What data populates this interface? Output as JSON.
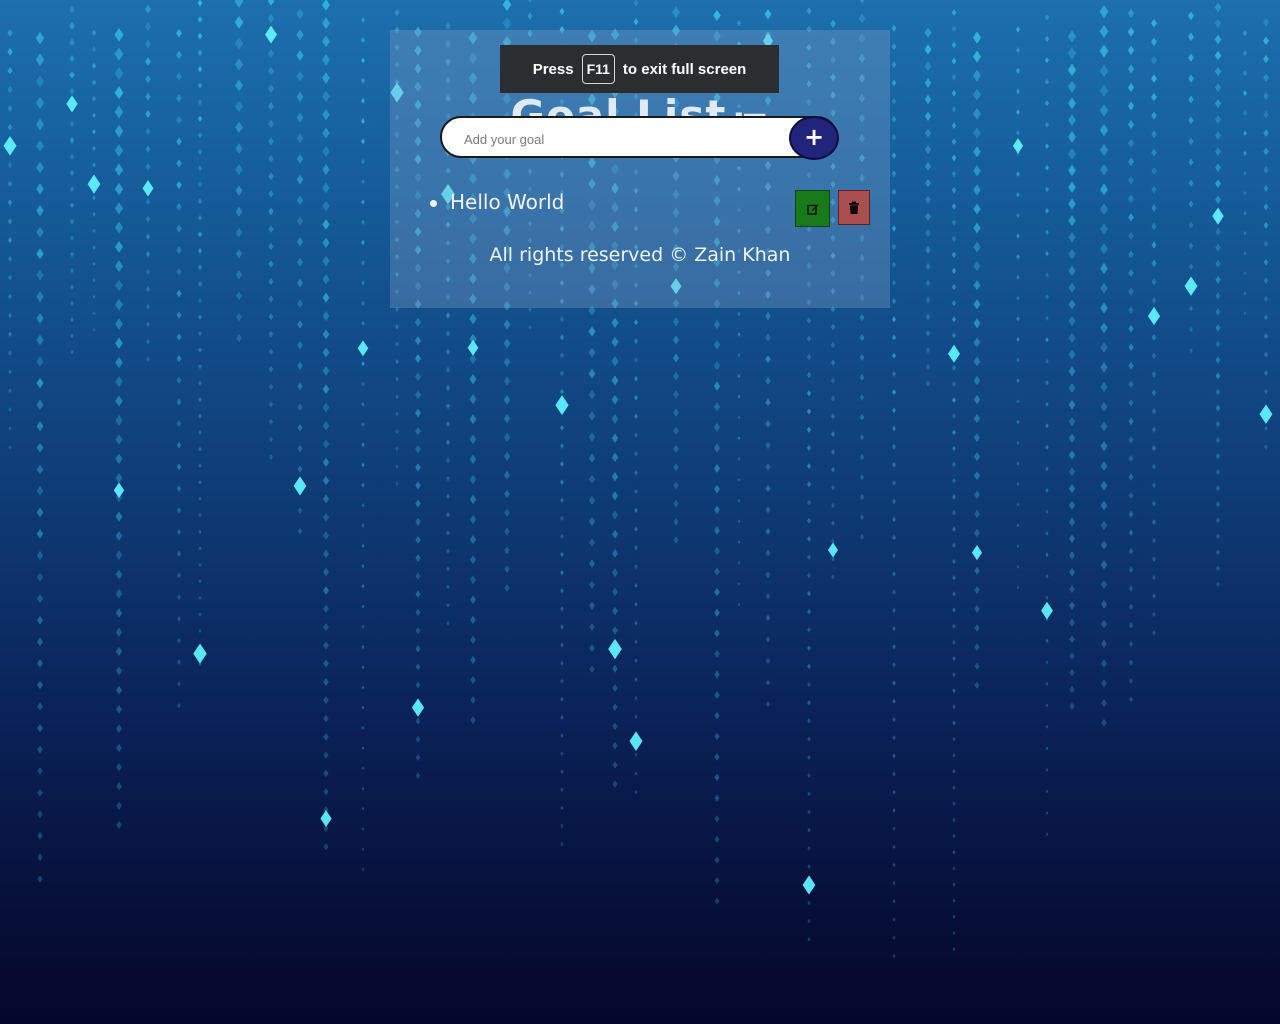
{
  "app": {
    "title": "Goal List",
    "title_icon": "list-icon"
  },
  "form": {
    "placeholder": "Add your goal",
    "value": "",
    "add_button_label": "+"
  },
  "goals": [
    {
      "text": "Hello World",
      "edit_icon": "edit-icon",
      "delete_icon": "trash-icon"
    }
  ],
  "footer": {
    "text": "All rights reserved © Zain Khan"
  },
  "fullscreen_notice": {
    "prefix": "Press",
    "key": "F11",
    "suffix": "to exit full screen"
  },
  "colors": {
    "add_button": "#22237a",
    "edit_button": "#197a1a",
    "delete_button": "#a94f50",
    "rain": "#3ad6f5"
  }
}
